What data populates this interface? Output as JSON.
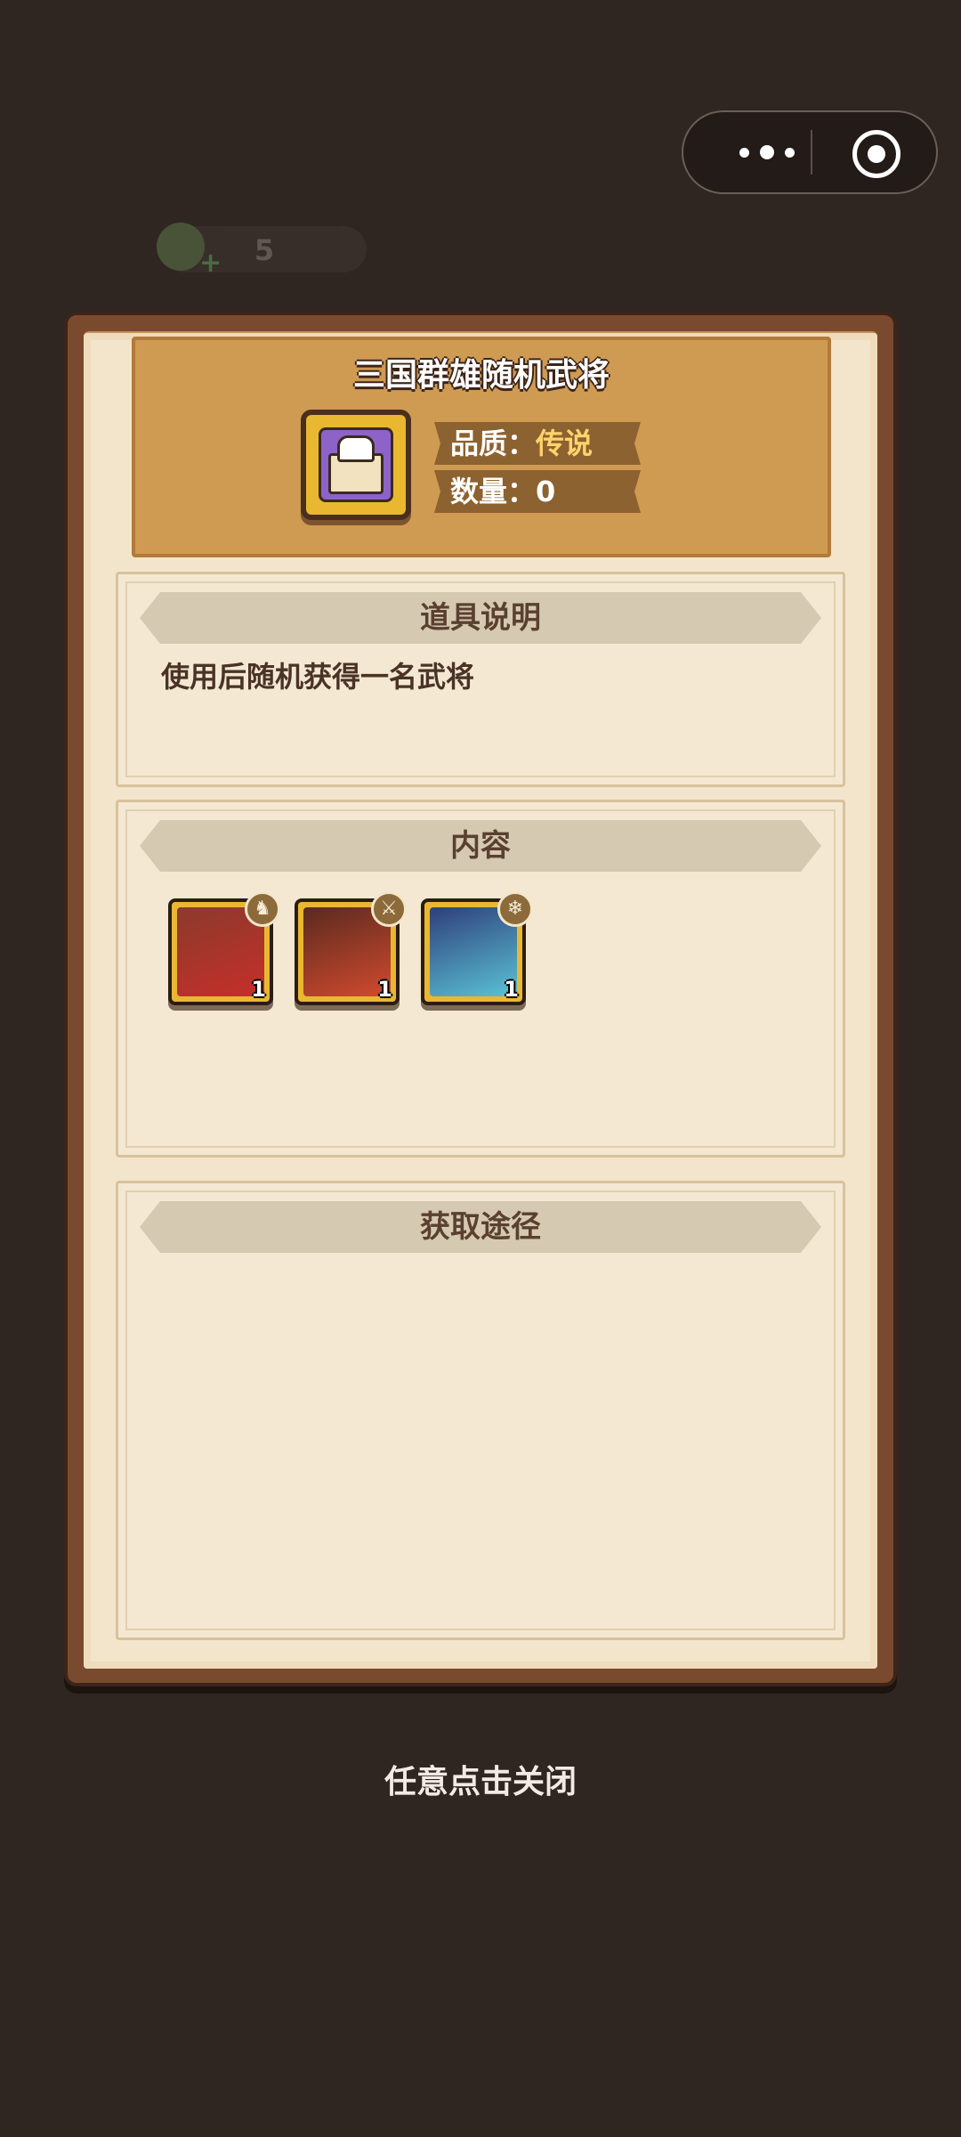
{
  "capsule": {
    "menu_icon": "more-dots-icon",
    "close_icon": "target-circle-icon"
  },
  "currency": {
    "value": "5",
    "icon": "coin-plus-icon"
  },
  "item": {
    "title": "三国群雄随机武将",
    "quality_label": "品质：",
    "quality_value": "传说",
    "count_label": "数量：",
    "count_value": "0",
    "icon": "chest-icon"
  },
  "sections": {
    "description": {
      "title": "道具说明",
      "text": "使用后随机获得一名武将"
    },
    "contents": {
      "title": "内容",
      "heroes": [
        {
          "name": "hero-1",
          "badge_icon": "horse-icon",
          "count": "1",
          "colors": [
            "#8b3a2c",
            "#c62f2a"
          ]
        },
        {
          "name": "hero-2",
          "badge_icon": "blade-icon",
          "count": "1",
          "colors": [
            "#5a2a1f",
            "#d14a2e"
          ]
        },
        {
          "name": "hero-3",
          "badge_icon": "snowflake-icon",
          "count": "1",
          "colors": [
            "#2f3f7a",
            "#5ac2d6"
          ]
        }
      ]
    },
    "sources": {
      "title": "获取途径"
    }
  },
  "close_hint": "任意点击关闭",
  "colors": {
    "background": "#2f2622",
    "legend": "#ffd36b",
    "paper": "#f2e5cc"
  }
}
